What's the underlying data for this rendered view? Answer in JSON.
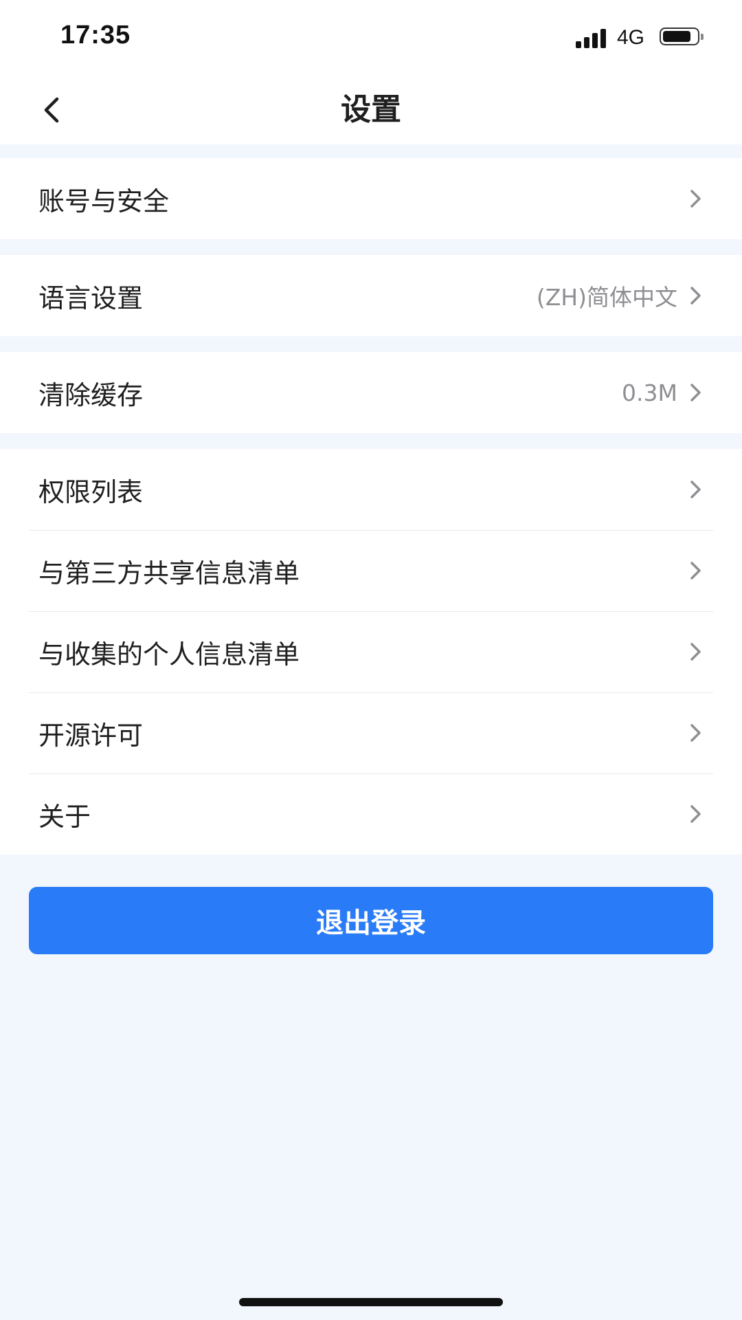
{
  "status_bar": {
    "time": "17:35",
    "network": "4G",
    "icons": [
      "signal-icon",
      "battery-icon"
    ]
  },
  "nav": {
    "title": "设置",
    "back_icon": "chevron-left-icon"
  },
  "groups": [
    {
      "items": [
        {
          "label": "账号与安全",
          "value": ""
        }
      ]
    },
    {
      "items": [
        {
          "label": "语言设置",
          "value": "(ZH)简体中文"
        }
      ]
    },
    {
      "items": [
        {
          "label": "清除缓存",
          "value": "0.3M"
        }
      ]
    },
    {
      "items": [
        {
          "label": "权限列表",
          "value": ""
        },
        {
          "label": "与第三方共享信息清单",
          "value": ""
        },
        {
          "label": "与收集的个人信息清单",
          "value": ""
        },
        {
          "label": "开源许可",
          "value": ""
        },
        {
          "label": "关于",
          "value": ""
        }
      ]
    }
  ],
  "logout_button": {
    "label": "退出登录"
  },
  "colors": {
    "accent": "#2A7BF7",
    "page_background": "#F2F6FD",
    "secondary_text": "#8E8E93"
  }
}
